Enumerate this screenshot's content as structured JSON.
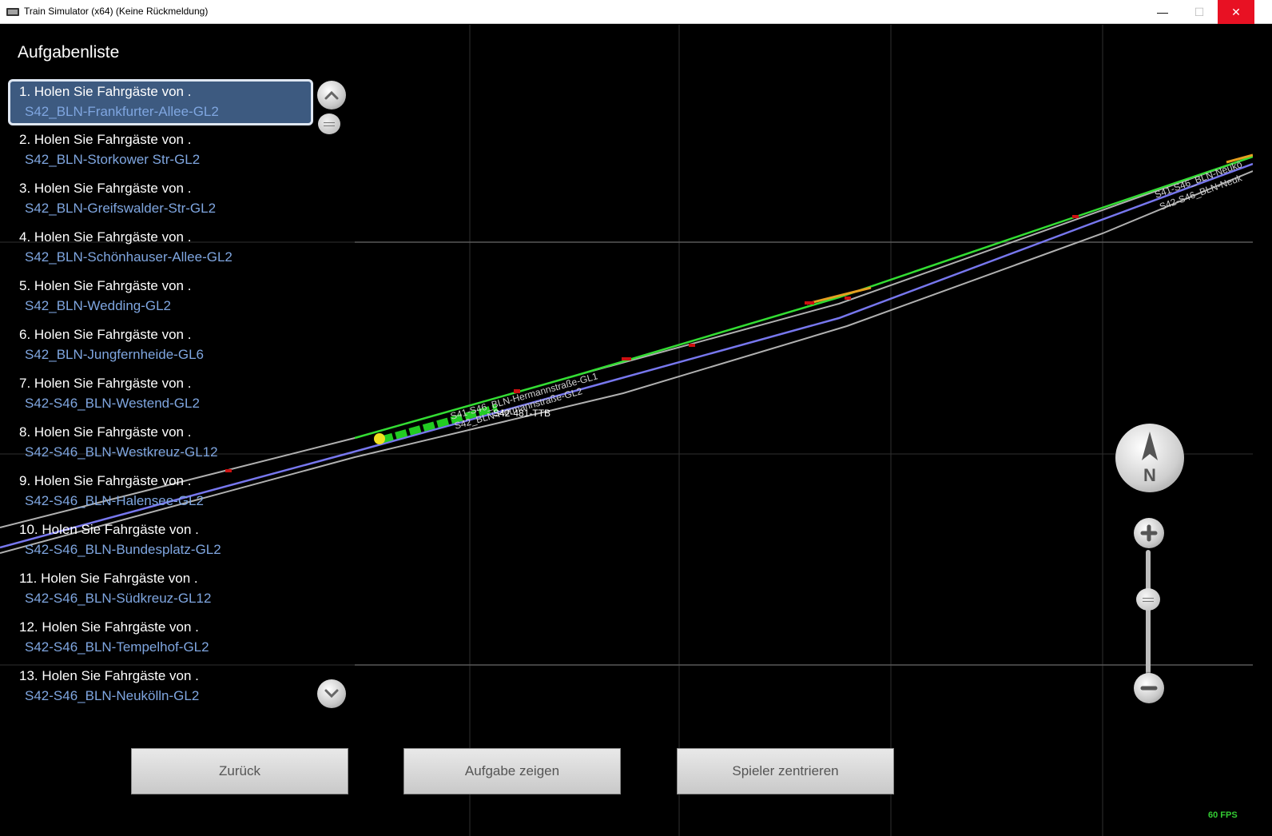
{
  "window": {
    "title": "Train Simulator (x64) (Keine Rückmeldung)",
    "min_glyph": "—",
    "max_glyph": "☐",
    "close_glyph": "✕"
  },
  "panel": {
    "title": "Aufgabenliste",
    "tasks": [
      {
        "label": "1. Holen Sie Fahrgäste von  .",
        "station": "S42_BLN-Frankfurter-Allee-GL2",
        "selected": true
      },
      {
        "label": "2. Holen Sie Fahrgäste von  .",
        "station": "S42_BLN-Storkower Str-GL2"
      },
      {
        "label": "3. Holen Sie Fahrgäste von  .",
        "station": "S42_BLN-Greifswalder-Str-GL2"
      },
      {
        "label": "4. Holen Sie Fahrgäste von  .",
        "station": "S42_BLN-Schönhauser-Allee-GL2"
      },
      {
        "label": "5. Holen Sie Fahrgäste von  .",
        "station": "S42_BLN-Wedding-GL2"
      },
      {
        "label": "6. Holen Sie Fahrgäste von  .",
        "station": "S42_BLN-Jungfernheide-GL6"
      },
      {
        "label": "7. Holen Sie Fahrgäste von  .",
        "station": "S42-S46_BLN-Westend-GL2"
      },
      {
        "label": "8. Holen Sie Fahrgäste von  .",
        "station": "S42-S46_BLN-Westkreuz-GL12"
      },
      {
        "label": "9. Holen Sie Fahrgäste von  .",
        "station": "S42-S46_BLN-Halensee-GL2"
      },
      {
        "label": "10. Holen Sie Fahrgäste von  .",
        "station": "S42-S46_BLN-Bundesplatz-GL2"
      },
      {
        "label": "11. Holen Sie Fahrgäste von  .",
        "station": "S42-S46_BLN-Südkreuz-GL12"
      },
      {
        "label": "12. Holen Sie Fahrgäste von  .",
        "station": "S42-S46_BLN-Tempelhof-GL2"
      },
      {
        "label": "13. Holen Sie Fahrgäste von  .",
        "station": "S42-S46_BLN-Neukölln-GL2"
      }
    ]
  },
  "map": {
    "labels": {
      "train": "S42-481-TTB",
      "track1": "S41-S46_BLN-Hermannstraße-GL1",
      "track2": "S42_BLN-Hermannstraße-GL2",
      "track3": "S41-S46_BLN-Neukö",
      "track4": "S42-S46_BLN-Neuk"
    },
    "compass_letter": "N",
    "colors": {
      "green": "#33dd33",
      "blue": "#7777ee",
      "grey": "#b8b8b8",
      "red": "#cc1111",
      "orange": "#e6a020",
      "yellow": "#f0e020"
    }
  },
  "buttons": {
    "back": "Zurück",
    "show_task": "Aufgabe zeigen",
    "center_player": "Spieler zentrieren"
  },
  "fps": "60 FPS"
}
